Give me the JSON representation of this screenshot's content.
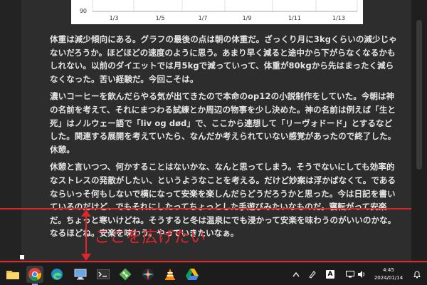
{
  "chart": {
    "y_tick_label": "90",
    "x_tick_labels": [
      "1/3",
      "1/5",
      "1/7",
      "1/9",
      "1/11",
      "1/13"
    ]
  },
  "article": {
    "paragraphs": [
      "体重は減少傾向にある。グラフの最後の点は朝の体重だ。ざっくり月に3kgくらいの減少じゃないだろうか。ほどほどの速度のように思う。あまり早く減ると途中から下がらなくなるかもしれない。以前のダイエットでは月5kgで減っていって、体重が80kgから先はまったく減らなくなった。苦い経験だ。今回こそは。",
      "濃いコーヒーを飲んだらやる気が出てきたので本命のop12の小説制作をしていた。今朝は神の名前を考えて、それにまつわる試練とか周辺の物事を少し決めた。神の名前は例えば「生と死」はノルウェー語で「liv og død」で、ここから連想して「リーヴォドード」とするなどした。関連する展開を考えていたら、なんだか考えられていない感覚があったので終了した。休憩。",
      "休憩と言いつつ、何かすることはないかな、なんと思ってしまう。そうでないにしても効率的なストレスの発散がしたい、というようなことを考える。だけど妙案は浮かばなくて。であるならいっそ何もしないで横になって安楽を楽しんだらどうだろうかと思った。今は日記を書いているのだけど、でもそれにしたってちょっとした手遊びみたいなものだ。寝転がって安楽だ。ちょっと寒いけどね。そうすると冬は温泉にでも浸かって安楽を味わうのがいいのかな。なるほどね。安楽を味わう。やっていきたいなぁ。"
    ]
  },
  "annotation": {
    "text": "ここを広げたい",
    "color": "#e0262c"
  },
  "taskbar": {
    "apps": [
      {
        "name": "file-explorer",
        "icon": "folder-icon"
      },
      {
        "name": "chrome",
        "icon": "chrome-icon",
        "active": true
      },
      {
        "name": "edge",
        "icon": "edge-icon"
      },
      {
        "name": "app-4",
        "icon": "computer-icon"
      },
      {
        "name": "terminal",
        "icon": "terminal-icon"
      },
      {
        "name": "git",
        "icon": "git-icon"
      },
      {
        "name": "app-7",
        "icon": "colorful-icon"
      },
      {
        "name": "vlc",
        "icon": "vlc-icon"
      },
      {
        "name": "google-drive",
        "icon": "drive-icon"
      }
    ],
    "tray": {
      "font_badge": "A",
      "time": "4:45",
      "date": "2024/01/14"
    }
  }
}
